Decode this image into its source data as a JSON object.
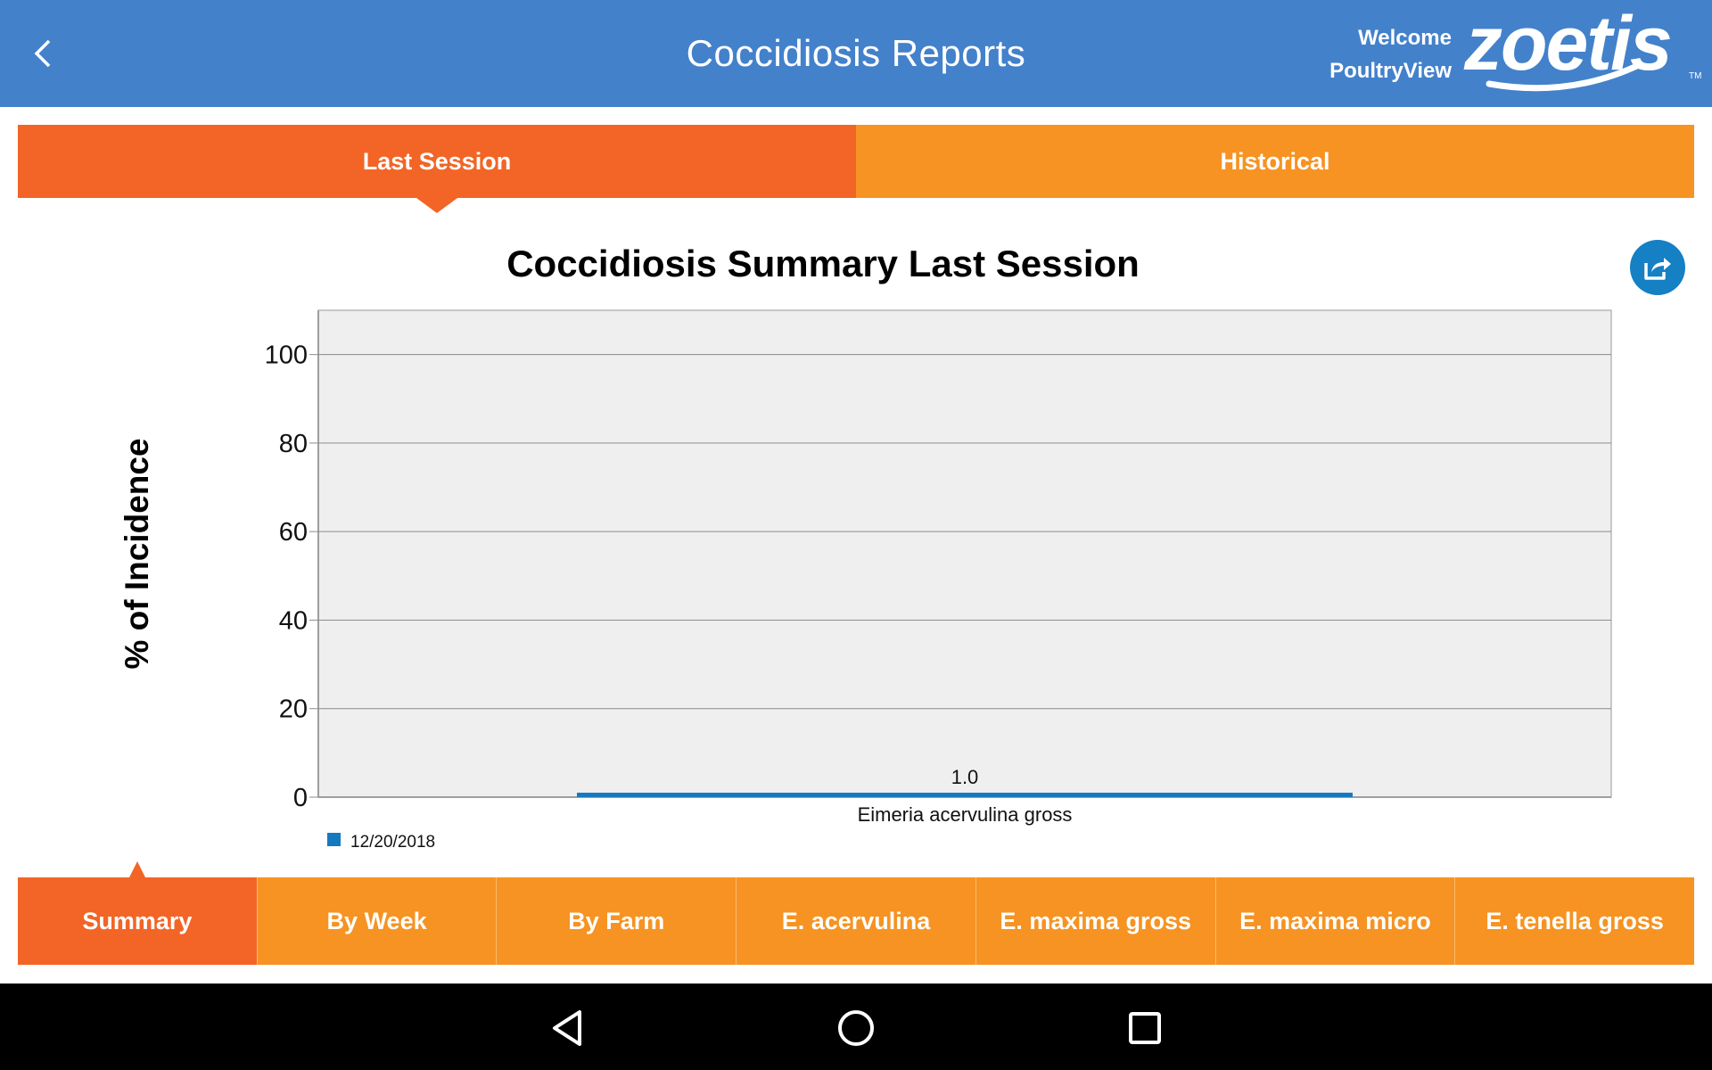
{
  "header": {
    "title": "Coccidiosis Reports",
    "welcome_line1": "Welcome",
    "welcome_line2": "PoultryView",
    "logo_text": "zoetis",
    "back_icon": "chevron-left-icon",
    "color": "#4381cb"
  },
  "top_tabs": [
    {
      "label": "Last Session",
      "active": true
    },
    {
      "label": "Historical",
      "active": false
    }
  ],
  "share_icon": "share-icon",
  "chart_data": {
    "type": "bar",
    "title": "Coccidiosis Summary Last Session",
    "xlabel": "",
    "ylabel": "% of Incidence",
    "categories": [
      "Eimeria acervulina gross"
    ],
    "series": [
      {
        "name": "12/20/2018",
        "values": [
          1.0
        ],
        "color": "#1579c0"
      }
    ],
    "data_labels": [
      "1.0"
    ],
    "ylim": [
      0,
      110
    ],
    "yticks": [
      0,
      20,
      40,
      60,
      80,
      100
    ],
    "grid": true,
    "legend": "bottom-left"
  },
  "bottom_tabs": [
    {
      "label": "Summary",
      "active": true
    },
    {
      "label": "By Week",
      "active": false
    },
    {
      "label": "By Farm",
      "active": false
    },
    {
      "label": "E. acervulina",
      "active": false
    },
    {
      "label": "E. maxima gross",
      "active": false
    },
    {
      "label": "E. maxima micro",
      "active": false
    },
    {
      "label": "E. tenella gross",
      "active": false
    }
  ],
  "colors": {
    "tab_active": "#f26526",
    "tab_inactive": "#f69322",
    "plot_background": "#efefef"
  },
  "android_nav": [
    "back-triangle-icon",
    "home-circle-icon",
    "recents-square-icon"
  ]
}
